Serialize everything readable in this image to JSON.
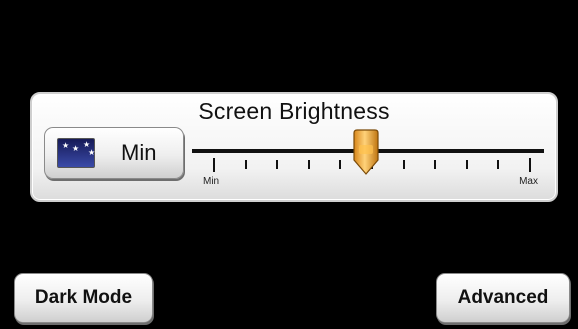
{
  "panel": {
    "title": "Screen Brightness",
    "preset_button_label": "Min",
    "preset_button_icon": "night-sky-icon"
  },
  "brightness_slider": {
    "min_label": "Min",
    "max_label": "Max",
    "value_fraction": 0.48,
    "tick_count": 11,
    "thumb_color": "#f0a830",
    "track_color": "#111111"
  },
  "footer": {
    "dark_mode_label": "Dark Mode",
    "advanced_label": "Advanced"
  }
}
